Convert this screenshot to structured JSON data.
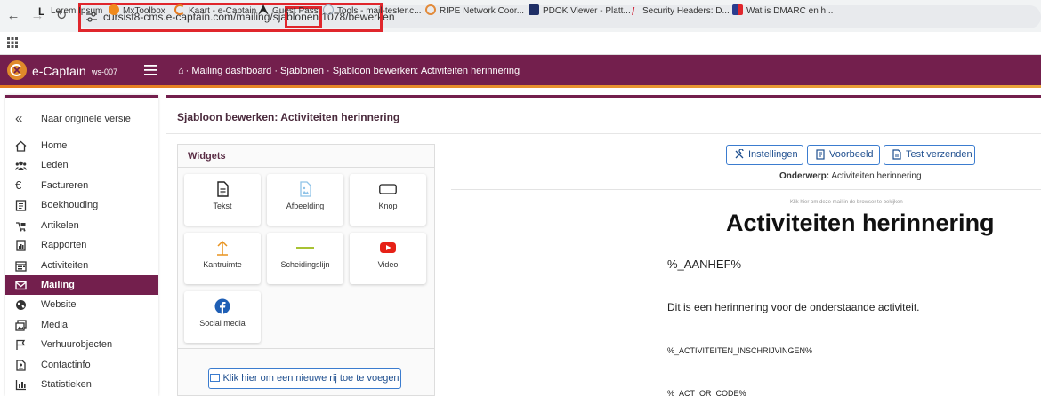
{
  "browser": {
    "url": "cursist8-cms.e-captain.com/mailing/sjablonen/1078/bewerken",
    "bookmarks": [
      {
        "label": "Lorem Ipsum",
        "icon": "lorem-ipsum-icon"
      },
      {
        "label": "MxToolbox",
        "icon": "mxtoolbox-icon"
      },
      {
        "label": "Kaart - e-Captain",
        "icon": "ecaptain-icon"
      },
      {
        "label": "Guest Pass",
        "icon": "guest-pass-icon"
      },
      {
        "label": "Tools - mail-tester.c...",
        "icon": "mail-tester-icon"
      },
      {
        "label": "RIPE Network Coor...",
        "icon": "ripe-icon"
      },
      {
        "label": "PDOK Viewer - Platt...",
        "icon": "pdok-icon"
      },
      {
        "label": "Security Headers: D...",
        "icon": "security-headers-icon"
      },
      {
        "label": "Wat is DMARC en h...",
        "icon": "dmarc-icon"
      }
    ]
  },
  "app": {
    "brand": "e-Captain",
    "brand_sub": "ws-007",
    "breadcrumb": "· Mailing dashboard · Sjablonen · Sjabloon bewerken: Activiteiten herinnering",
    "accent": "#731f4d",
    "stripe": "#e8a33b"
  },
  "sidebar": {
    "items": [
      {
        "label": "Naar originele versie",
        "icon": "double-chevron-left-icon"
      },
      {
        "label": "Home",
        "icon": "home-icon"
      },
      {
        "label": "Leden",
        "icon": "users-icon"
      },
      {
        "label": "Factureren",
        "icon": "euro-icon"
      },
      {
        "label": "Boekhouding",
        "icon": "ledger-icon"
      },
      {
        "label": "Artikelen",
        "icon": "articles-icon"
      },
      {
        "label": "Rapporten",
        "icon": "report-icon"
      },
      {
        "label": "Activiteiten",
        "icon": "calendar-icon"
      },
      {
        "label": "Mailing",
        "icon": "mail-icon"
      },
      {
        "label": "Website",
        "icon": "globe-icon"
      },
      {
        "label": "Media",
        "icon": "media-icon"
      },
      {
        "label": "Verhuurobjecten",
        "icon": "rental-icon"
      },
      {
        "label": "Contactinfo",
        "icon": "contact-icon"
      },
      {
        "label": "Statistieken",
        "icon": "stats-icon"
      }
    ],
    "active_index": 8
  },
  "main": {
    "title": "Sjabloon bewerken: Activiteiten herinnering",
    "widgets": {
      "title": "Widgets",
      "items": [
        {
          "label": "Tekst",
          "icon": "text-document-icon"
        },
        {
          "label": "Afbeelding",
          "icon": "image-icon"
        },
        {
          "label": "Knop",
          "icon": "button-icon"
        },
        {
          "label": "Kantruimte",
          "icon": "spacer-icon"
        },
        {
          "label": "Scheidingslijn",
          "icon": "divider-icon"
        },
        {
          "label": "Video",
          "icon": "youtube-icon"
        },
        {
          "label": "Social media",
          "icon": "facebook-icon"
        }
      ],
      "add_row": "Klik hier om een nieuwe rij toe te voegen"
    },
    "preview": {
      "buttons": [
        {
          "label": "Instellingen",
          "icon": "settings-tools-icon"
        },
        {
          "label": "Voorbeeld",
          "icon": "preview-icon"
        },
        {
          "label": "Test verzenden",
          "icon": "send-test-icon"
        }
      ],
      "subject_label": "Onderwerp:",
      "subject_value": "Activiteiten herinnering",
      "browser_link": "Klik hier om deze mail in de browser te bekijken",
      "heading": "Activiteiten herinnering",
      "paragraphs": [
        "%_AANHEF%",
        "Dit is een herinnering voor de onderstaande activiteit.",
        "%_ACTIVITEITEN_INSCHRIJVINGEN%",
        "%_ACT_QR_CODE%"
      ]
    }
  }
}
